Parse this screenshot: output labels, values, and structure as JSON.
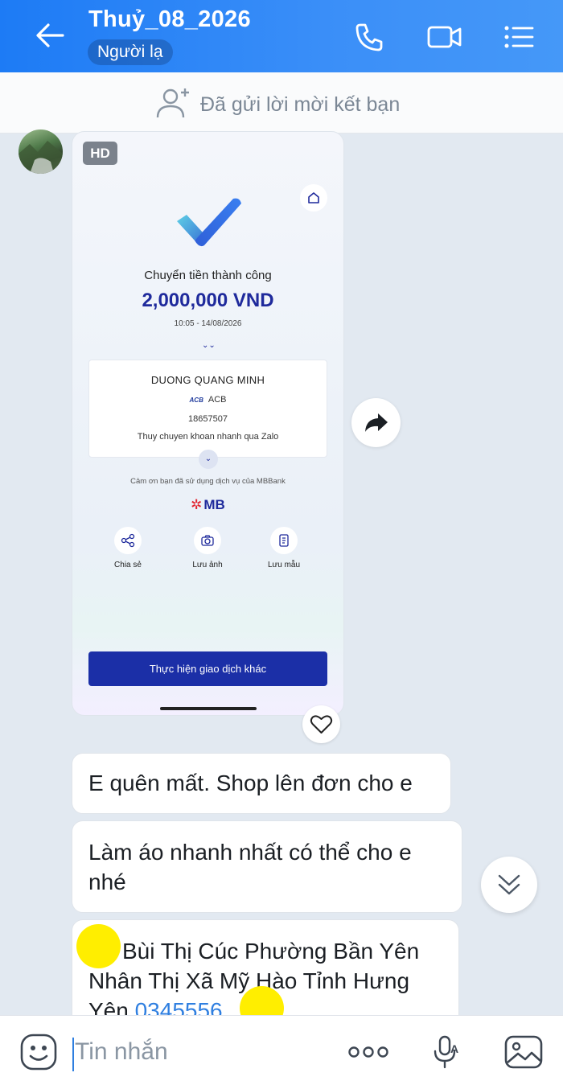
{
  "header": {
    "title": "Thuỷ_08_2026",
    "tag": "Người lạ"
  },
  "friend_bar": {
    "text": "Đã gửi lời mời kết bạn"
  },
  "image_message": {
    "badge": "HD",
    "receipt": {
      "status": "Chuyển tiền thành công",
      "amount": "2,000,000 VND",
      "time": "10:05 - 14/08/2026",
      "recipient_name": "DUONG QUANG MINH",
      "bank_logo_text": "ACB",
      "bank": "ACB",
      "account": "18657507",
      "description": "Thuy chuyen khoan nhanh qua Zalo",
      "thanks": "Cảm ơn bạn đã sử dụng dịch vụ của MBBank",
      "brand": "MB",
      "actions": [
        {
          "label": "Chia sẻ",
          "icon": "share-icon"
        },
        {
          "label": "Lưu ảnh",
          "icon": "camera-icon"
        },
        {
          "label": "Lưu mẫu",
          "icon": "template-icon"
        }
      ],
      "primary_button": "Thực hiện giao dịch khác"
    }
  },
  "messages": [
    {
      "text": "E quên mất. Shop lên đơn cho e"
    },
    {
      "text": "Làm áo nhanh nhất có thể cho e nhé"
    },
    {
      "text": "Bùi Thị Cúc Phường Bần Yên Nhân Thị Xã Mỹ Hào Tỉnh Hưng Yên",
      "phone": "0345556"
    }
  ],
  "input": {
    "placeholder": "Tin nhắn"
  },
  "colors": {
    "header_blue": "#1d7bf5",
    "chat_bg": "#e2e9f1",
    "mb_navy": "#1f2a9c",
    "link_blue": "#2f7fe0",
    "highlight_yellow": "#ffee00"
  }
}
